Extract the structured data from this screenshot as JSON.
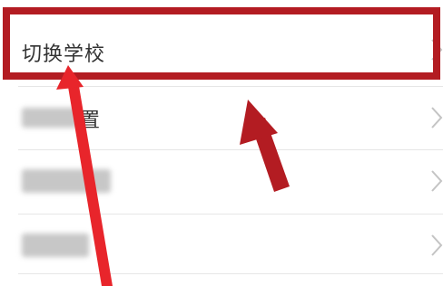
{
  "settings_list": {
    "items": [
      {
        "label": "切换学校",
        "obscured": false
      },
      {
        "label": "置",
        "obscured": true
      },
      {
        "label": "",
        "obscured": true
      },
      {
        "label": "",
        "obscured": true
      }
    ]
  },
  "annotation": {
    "highlight_color": "#b31c22",
    "arrow_color": "#e8252b",
    "arrow_color_dark": "#b31c22"
  },
  "icons": {
    "chevron": "chevron-right-icon"
  }
}
